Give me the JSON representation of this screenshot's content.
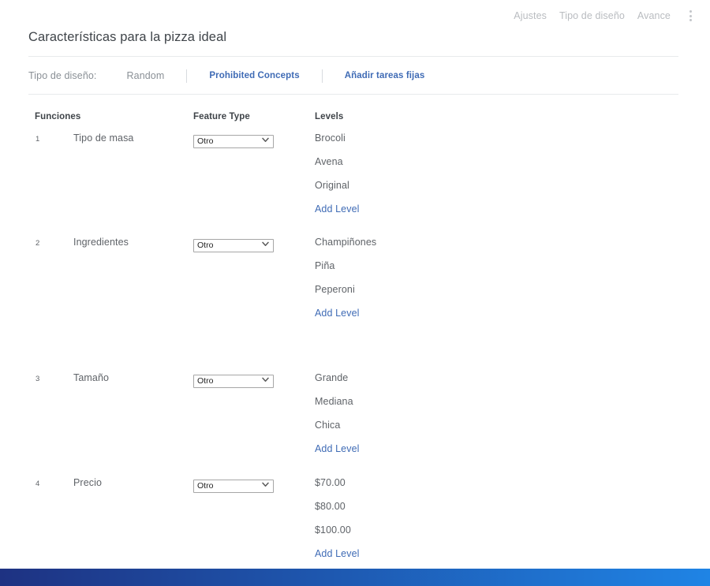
{
  "topbar": {
    "links": [
      {
        "label": "Ajustes"
      },
      {
        "label": "Tipo de diseño"
      },
      {
        "label": "Avance"
      }
    ],
    "menu_icon": "kebab-menu-icon"
  },
  "page": {
    "title": "Características para la pizza ideal"
  },
  "toolbar": {
    "design_type_label": "Tipo de diseño:",
    "design_type_value": "Random",
    "prohibited_concepts_label": "Prohibited Concepts",
    "add_fixed_tasks_label": "Añadir tareas fijas"
  },
  "table": {
    "headers": {
      "functions": "Funciones",
      "feature_type": "Feature Type",
      "levels": "Levels"
    },
    "add_level_label": "Add Level",
    "rows": [
      {
        "number": "1",
        "name": "Tipo de masa",
        "feature_type": "Otro",
        "levels": [
          "Brocoli",
          "Avena",
          "Original"
        ]
      },
      {
        "number": "2",
        "name": "Ingredientes",
        "feature_type": "Otro",
        "levels": [
          "Champiñones",
          "Piña",
          "Peperoni"
        ]
      },
      {
        "number": "3",
        "name": "Tamaño",
        "feature_type": "Otro",
        "levels": [
          "Grande",
          "Mediana",
          "Chica"
        ]
      },
      {
        "number": "4",
        "name": "Precio",
        "feature_type": "Otro",
        "levels": [
          "$70.00",
          "$80.00",
          "$100.00"
        ]
      }
    ]
  },
  "colors": {
    "link_blue": "#3f6bb5",
    "bottom_bar_start": "#1e3282",
    "bottom_bar_end": "#1f84e5",
    "text_muted": "#8a9096",
    "text_body": "#5f6368"
  }
}
